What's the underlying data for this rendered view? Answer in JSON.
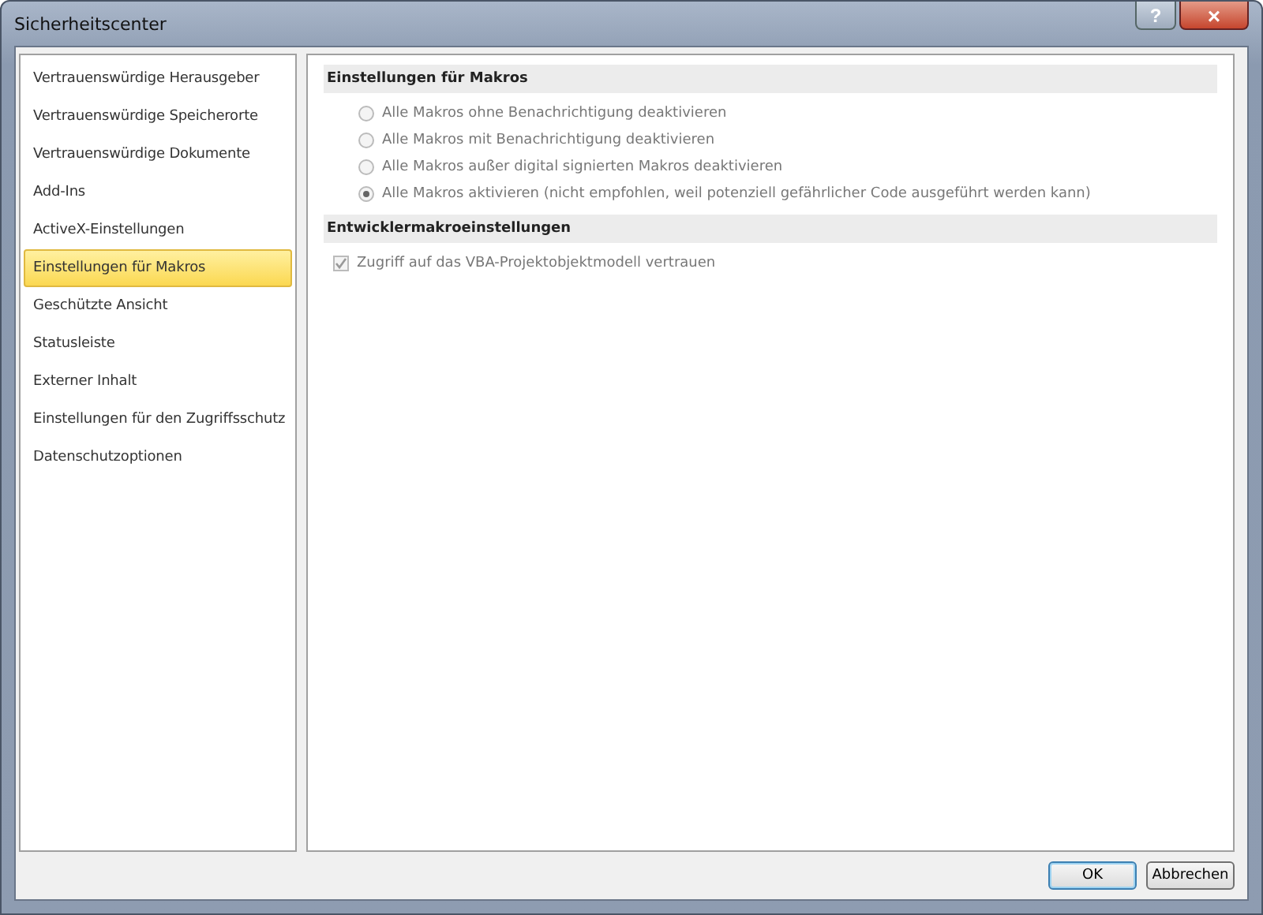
{
  "window": {
    "title": "Sicherheitscenter",
    "help": "?",
    "close": "×"
  },
  "sidebar": {
    "items": [
      {
        "label": "Vertrauenswürdige Herausgeber",
        "selected": false
      },
      {
        "label": "Vertrauenswürdige Speicherorte",
        "selected": false
      },
      {
        "label": "Vertrauenswürdige Dokumente",
        "selected": false
      },
      {
        "label": "Add-Ins",
        "selected": false
      },
      {
        "label": "ActiveX-Einstellungen",
        "selected": false
      },
      {
        "label": "Einstellungen für Makros",
        "selected": true
      },
      {
        "label": "Geschützte Ansicht",
        "selected": false
      },
      {
        "label": "Statusleiste",
        "selected": false
      },
      {
        "label": "Externer Inhalt",
        "selected": false
      },
      {
        "label": "Einstellungen für den Zugriffsschutz",
        "selected": false
      },
      {
        "label": "Datenschutzoptionen",
        "selected": false
      }
    ]
  },
  "sections": [
    {
      "title": "Einstellungen für Makros",
      "options": [
        {
          "kind": "radio",
          "label": "Alle Makros ohne Benachrichtigung deaktivieren",
          "selected": false,
          "disabled": true
        },
        {
          "kind": "radio",
          "label": "Alle Makros mit Benachrichtigung deaktivieren",
          "selected": false,
          "disabled": true
        },
        {
          "kind": "radio",
          "label": "Alle Makros außer digital signierten Makros deaktivieren",
          "selected": false,
          "disabled": true
        },
        {
          "kind": "radio",
          "label": "Alle Makros aktivieren (nicht empfohlen, weil potenziell gefährlicher Code ausgeführt werden kann)",
          "selected": true,
          "disabled": true
        }
      ]
    },
    {
      "title": "Entwicklermakroeinstellungen",
      "options": [
        {
          "kind": "checkbox",
          "label": "Zugriff auf das VBA-Projektobjektmodell vertrauen",
          "checked": true,
          "disabled": true
        }
      ]
    }
  ],
  "buttons": [
    {
      "label": "OK",
      "default": true
    },
    {
      "label": "Abbrechen",
      "default": false
    }
  ]
}
